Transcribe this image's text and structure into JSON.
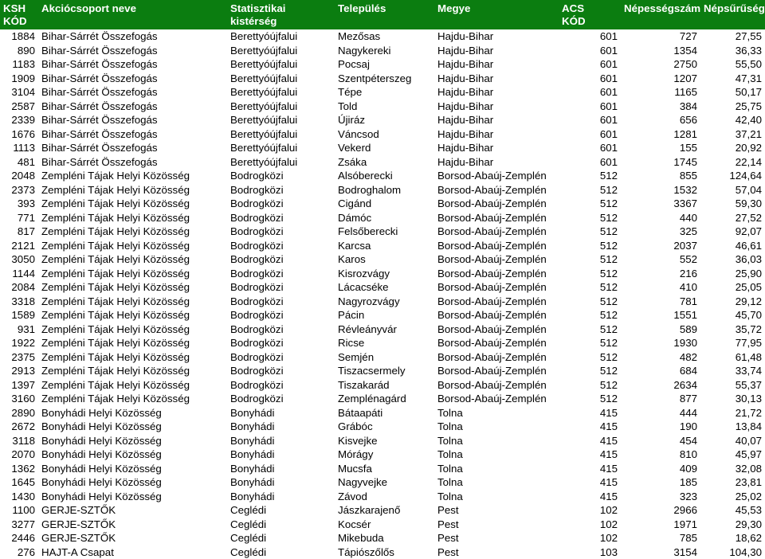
{
  "table": {
    "headers": {
      "ksh": "KSH KÓD",
      "ksh_line1": "KSH",
      "ksh_line2": "KÓD",
      "name": "Akciócsoport neve",
      "kisterseg": "Statisztikai kistérség",
      "telepules": "Település",
      "megye": "Megye",
      "acs_line1": "ACS",
      "acs_line2": "KÓD",
      "nepesseg": "Népességszám",
      "nepsuruseg": "Népsűrűség"
    },
    "header_bg": "#0b7d10",
    "header_fg": "#ffffff",
    "rows": [
      {
        "ksh": "1884",
        "name": "Bihar-Sárrét Összefogás",
        "kisterseg": "Berettyóújfalui",
        "telepules": "Mezősas",
        "megye": "Hajdu-Bihar",
        "acs": "601",
        "nepesseg": "727",
        "nepsuruseg": "27,55"
      },
      {
        "ksh": "890",
        "name": "Bihar-Sárrét Összefogás",
        "kisterseg": "Berettyóújfalui",
        "telepules": "Nagykereki",
        "megye": "Hajdu-Bihar",
        "acs": "601",
        "nepesseg": "1354",
        "nepsuruseg": "36,33"
      },
      {
        "ksh": "1183",
        "name": "Bihar-Sárrét Összefogás",
        "kisterseg": "Berettyóújfalui",
        "telepules": "Pocsaj",
        "megye": "Hajdu-Bihar",
        "acs": "601",
        "nepesseg": "2750",
        "nepsuruseg": "55,50"
      },
      {
        "ksh": "1909",
        "name": "Bihar-Sárrét Összefogás",
        "kisterseg": "Berettyóújfalui",
        "telepules": "Szentpéterszeg",
        "megye": "Hajdu-Bihar",
        "acs": "601",
        "nepesseg": "1207",
        "nepsuruseg": "47,31"
      },
      {
        "ksh": "3104",
        "name": "Bihar-Sárrét Összefogás",
        "kisterseg": "Berettyóújfalui",
        "telepules": "Tépe",
        "megye": "Hajdu-Bihar",
        "acs": "601",
        "nepesseg": "1165",
        "nepsuruseg": "50,17"
      },
      {
        "ksh": "2587",
        "name": "Bihar-Sárrét Összefogás",
        "kisterseg": "Berettyóújfalui",
        "telepules": "Told",
        "megye": "Hajdu-Bihar",
        "acs": "601",
        "nepesseg": "384",
        "nepsuruseg": "25,75"
      },
      {
        "ksh": "2339",
        "name": "Bihar-Sárrét Összefogás",
        "kisterseg": "Berettyóújfalui",
        "telepules": "Újiráz",
        "megye": "Hajdu-Bihar",
        "acs": "601",
        "nepesseg": "656",
        "nepsuruseg": "42,40"
      },
      {
        "ksh": "1676",
        "name": "Bihar-Sárrét Összefogás",
        "kisterseg": "Berettyóújfalui",
        "telepules": "Váncsod",
        "megye": "Hajdu-Bihar",
        "acs": "601",
        "nepesseg": "1281",
        "nepsuruseg": "37,21"
      },
      {
        "ksh": "1113",
        "name": "Bihar-Sárrét Összefogás",
        "kisterseg": "Berettyóújfalui",
        "telepules": "Vekerd",
        "megye": "Hajdu-Bihar",
        "acs": "601",
        "nepesseg": "155",
        "nepsuruseg": "20,92"
      },
      {
        "ksh": "481",
        "name": "Bihar-Sárrét Összefogás",
        "kisterseg": "Berettyóújfalui",
        "telepules": "Zsáka",
        "megye": "Hajdu-Bihar",
        "acs": "601",
        "nepesseg": "1745",
        "nepsuruseg": "22,14"
      },
      {
        "ksh": "2048",
        "name": "Zempléni Tájak Helyi Közösség",
        "kisterseg": "Bodrogközi",
        "telepules": "Alsóberecki",
        "megye": "Borsod-Abaúj-Zemplén",
        "acs": "512",
        "nepesseg": "855",
        "nepsuruseg": "124,64"
      },
      {
        "ksh": "2373",
        "name": "Zempléni Tájak Helyi Közösség",
        "kisterseg": "Bodrogközi",
        "telepules": "Bodroghalom",
        "megye": "Borsod-Abaúj-Zemplén",
        "acs": "512",
        "nepesseg": "1532",
        "nepsuruseg": "57,04"
      },
      {
        "ksh": "393",
        "name": "Zempléni Tájak Helyi Közösség",
        "kisterseg": "Bodrogközi",
        "telepules": "Cigánd",
        "megye": "Borsod-Abaúj-Zemplén",
        "acs": "512",
        "nepesseg": "3367",
        "nepsuruseg": "59,30"
      },
      {
        "ksh": "771",
        "name": "Zempléni Tájak Helyi Közösség",
        "kisterseg": "Bodrogközi",
        "telepules": "Dámóc",
        "megye": "Borsod-Abaúj-Zemplén",
        "acs": "512",
        "nepesseg": "440",
        "nepsuruseg": "27,52"
      },
      {
        "ksh": "817",
        "name": "Zempléni Tájak Helyi Közösség",
        "kisterseg": "Bodrogközi",
        "telepules": "Felsőberecki",
        "megye": "Borsod-Abaúj-Zemplén",
        "acs": "512",
        "nepesseg": "325",
        "nepsuruseg": "92,07"
      },
      {
        "ksh": "2121",
        "name": "Zempléni Tájak Helyi Közösség",
        "kisterseg": "Bodrogközi",
        "telepules": "Karcsa",
        "megye": "Borsod-Abaúj-Zemplén",
        "acs": "512",
        "nepesseg": "2037",
        "nepsuruseg": "46,61"
      },
      {
        "ksh": "3050",
        "name": "Zempléni Tájak Helyi Közösség",
        "kisterseg": "Bodrogközi",
        "telepules": "Karos",
        "megye": "Borsod-Abaúj-Zemplén",
        "acs": "512",
        "nepesseg": "552",
        "nepsuruseg": "36,03"
      },
      {
        "ksh": "1144",
        "name": "Zempléni Tájak Helyi Közösség",
        "kisterseg": "Bodrogközi",
        "telepules": "Kisrozvágy",
        "megye": "Borsod-Abaúj-Zemplén",
        "acs": "512",
        "nepesseg": "216",
        "nepsuruseg": "25,90"
      },
      {
        "ksh": "2084",
        "name": "Zempléni Tájak Helyi Közösség",
        "kisterseg": "Bodrogközi",
        "telepules": "Lácacséke",
        "megye": "Borsod-Abaúj-Zemplén",
        "acs": "512",
        "nepesseg": "410",
        "nepsuruseg": "25,05"
      },
      {
        "ksh": "3318",
        "name": "Zempléni Tájak Helyi Közösség",
        "kisterseg": "Bodrogközi",
        "telepules": "Nagyrozvágy",
        "megye": "Borsod-Abaúj-Zemplén",
        "acs": "512",
        "nepesseg": "781",
        "nepsuruseg": "29,12"
      },
      {
        "ksh": "1589",
        "name": "Zempléni Tájak Helyi Közösség",
        "kisterseg": "Bodrogközi",
        "telepules": "Pácin",
        "megye": "Borsod-Abaúj-Zemplén",
        "acs": "512",
        "nepesseg": "1551",
        "nepsuruseg": "45,70"
      },
      {
        "ksh": "931",
        "name": "Zempléni Tájak Helyi Közösség",
        "kisterseg": "Bodrogközi",
        "telepules": "Révleányvár",
        "megye": "Borsod-Abaúj-Zemplén",
        "acs": "512",
        "nepesseg": "589",
        "nepsuruseg": "35,72"
      },
      {
        "ksh": "1922",
        "name": "Zempléni Tájak Helyi Közösség",
        "kisterseg": "Bodrogközi",
        "telepules": "Ricse",
        "megye": "Borsod-Abaúj-Zemplén",
        "acs": "512",
        "nepesseg": "1930",
        "nepsuruseg": "77,95"
      },
      {
        "ksh": "2375",
        "name": "Zempléni Tájak Helyi Közösség",
        "kisterseg": "Bodrogközi",
        "telepules": "Semjén",
        "megye": "Borsod-Abaúj-Zemplén",
        "acs": "512",
        "nepesseg": "482",
        "nepsuruseg": "61,48"
      },
      {
        "ksh": "2913",
        "name": "Zempléni Tájak Helyi Közösség",
        "kisterseg": "Bodrogközi",
        "telepules": "Tiszacsermely",
        "megye": "Borsod-Abaúj-Zemplén",
        "acs": "512",
        "nepesseg": "684",
        "nepsuruseg": "33,74"
      },
      {
        "ksh": "1397",
        "name": "Zempléni Tájak Helyi Közösség",
        "kisterseg": "Bodrogközi",
        "telepules": "Tiszakarád",
        "megye": "Borsod-Abaúj-Zemplén",
        "acs": "512",
        "nepesseg": "2634",
        "nepsuruseg": "55,37"
      },
      {
        "ksh": "3160",
        "name": "Zempléni Tájak Helyi Közösség",
        "kisterseg": "Bodrogközi",
        "telepules": "Zemplénagárd",
        "megye": "Borsod-Abaúj-Zemplén",
        "acs": "512",
        "nepesseg": "877",
        "nepsuruseg": "30,13"
      },
      {
        "ksh": "2890",
        "name": "Bonyhádi Helyi Közösség",
        "kisterseg": "Bonyhádi",
        "telepules": "Bátaapáti",
        "megye": "Tolna",
        "acs": "415",
        "nepesseg": "444",
        "nepsuruseg": "21,72"
      },
      {
        "ksh": "2672",
        "name": "Bonyhádi Helyi Közösség",
        "kisterseg": "Bonyhádi",
        "telepules": "Grábóc",
        "megye": "Tolna",
        "acs": "415",
        "nepesseg": "190",
        "nepsuruseg": "13,84"
      },
      {
        "ksh": "3118",
        "name": "Bonyhádi Helyi Közösség",
        "kisterseg": "Bonyhádi",
        "telepules": "Kisvejke",
        "megye": "Tolna",
        "acs": "415",
        "nepesseg": "454",
        "nepsuruseg": "40,07"
      },
      {
        "ksh": "2070",
        "name": "Bonyhádi Helyi Közösség",
        "kisterseg": "Bonyhádi",
        "telepules": "Mórágy",
        "megye": "Tolna",
        "acs": "415",
        "nepesseg": "810",
        "nepsuruseg": "45,97"
      },
      {
        "ksh": "1362",
        "name": "Bonyhádi Helyi Közösség",
        "kisterseg": "Bonyhádi",
        "telepules": "Mucsfa",
        "megye": "Tolna",
        "acs": "415",
        "nepesseg": "409",
        "nepsuruseg": "32,08"
      },
      {
        "ksh": "1645",
        "name": "Bonyhádi Helyi Közösség",
        "kisterseg": "Bonyhádi",
        "telepules": "Nagyvejke",
        "megye": "Tolna",
        "acs": "415",
        "nepesseg": "185",
        "nepsuruseg": "23,81"
      },
      {
        "ksh": "1430",
        "name": "Bonyhádi Helyi Közösség",
        "kisterseg": "Bonyhádi",
        "telepules": "Závod",
        "megye": "Tolna",
        "acs": "415",
        "nepesseg": "323",
        "nepsuruseg": "25,02"
      },
      {
        "ksh": "1100",
        "name": "GERJE-SZTŐK",
        "kisterseg": "Ceglédi",
        "telepules": "Jászkarajenő",
        "megye": "Pest",
        "acs": "102",
        "nepesseg": "2966",
        "nepsuruseg": "45,53"
      },
      {
        "ksh": "3277",
        "name": "GERJE-SZTŐK",
        "kisterseg": "Ceglédi",
        "telepules": "Kocsér",
        "megye": "Pest",
        "acs": "102",
        "nepesseg": "1971",
        "nepsuruseg": "29,30"
      },
      {
        "ksh": "2446",
        "name": "GERJE-SZTŐK",
        "kisterseg": "Ceglédi",
        "telepules": "Mikebuda",
        "megye": "Pest",
        "acs": "102",
        "nepesseg": "785",
        "nepsuruseg": "18,62"
      },
      {
        "ksh": "276",
        "name": "HAJT-A Csapat",
        "kisterseg": "Ceglédi",
        "telepules": "Tápiószőlős",
        "megye": "Pest",
        "acs": "103",
        "nepesseg": "3154",
        "nepsuruseg": "104,30"
      }
    ]
  }
}
